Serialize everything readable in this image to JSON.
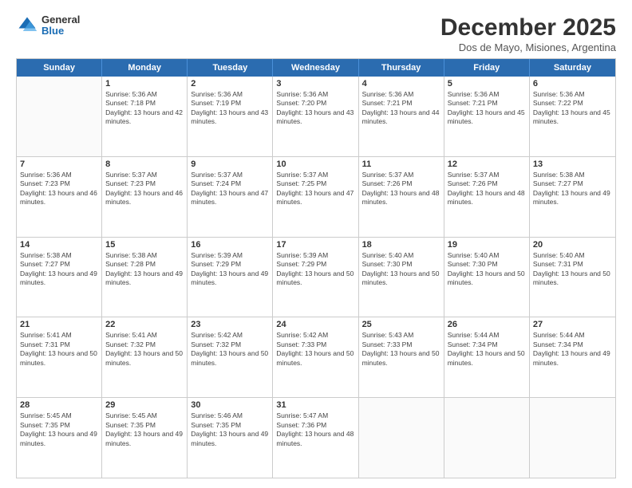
{
  "logo": {
    "general": "General",
    "blue": "Blue"
  },
  "title": "December 2025",
  "subtitle": "Dos de Mayo, Misiones, Argentina",
  "days": [
    "Sunday",
    "Monday",
    "Tuesday",
    "Wednesday",
    "Thursday",
    "Friday",
    "Saturday"
  ],
  "weeks": [
    [
      {
        "day": "",
        "empty": true
      },
      {
        "day": "1",
        "sunrise": "Sunrise: 5:36 AM",
        "sunset": "Sunset: 7:18 PM",
        "daylight": "Daylight: 13 hours and 42 minutes."
      },
      {
        "day": "2",
        "sunrise": "Sunrise: 5:36 AM",
        "sunset": "Sunset: 7:19 PM",
        "daylight": "Daylight: 13 hours and 43 minutes."
      },
      {
        "day": "3",
        "sunrise": "Sunrise: 5:36 AM",
        "sunset": "Sunset: 7:20 PM",
        "daylight": "Daylight: 13 hours and 43 minutes."
      },
      {
        "day": "4",
        "sunrise": "Sunrise: 5:36 AM",
        "sunset": "Sunset: 7:21 PM",
        "daylight": "Daylight: 13 hours and 44 minutes."
      },
      {
        "day": "5",
        "sunrise": "Sunrise: 5:36 AM",
        "sunset": "Sunset: 7:21 PM",
        "daylight": "Daylight: 13 hours and 45 minutes."
      },
      {
        "day": "6",
        "sunrise": "Sunrise: 5:36 AM",
        "sunset": "Sunset: 7:22 PM",
        "daylight": "Daylight: 13 hours and 45 minutes."
      }
    ],
    [
      {
        "day": "7",
        "sunrise": "Sunrise: 5:36 AM",
        "sunset": "Sunset: 7:23 PM",
        "daylight": "Daylight: 13 hours and 46 minutes."
      },
      {
        "day": "8",
        "sunrise": "Sunrise: 5:37 AM",
        "sunset": "Sunset: 7:23 PM",
        "daylight": "Daylight: 13 hours and 46 minutes."
      },
      {
        "day": "9",
        "sunrise": "Sunrise: 5:37 AM",
        "sunset": "Sunset: 7:24 PM",
        "daylight": "Daylight: 13 hours and 47 minutes."
      },
      {
        "day": "10",
        "sunrise": "Sunrise: 5:37 AM",
        "sunset": "Sunset: 7:25 PM",
        "daylight": "Daylight: 13 hours and 47 minutes."
      },
      {
        "day": "11",
        "sunrise": "Sunrise: 5:37 AM",
        "sunset": "Sunset: 7:26 PM",
        "daylight": "Daylight: 13 hours and 48 minutes."
      },
      {
        "day": "12",
        "sunrise": "Sunrise: 5:37 AM",
        "sunset": "Sunset: 7:26 PM",
        "daylight": "Daylight: 13 hours and 48 minutes."
      },
      {
        "day": "13",
        "sunrise": "Sunrise: 5:38 AM",
        "sunset": "Sunset: 7:27 PM",
        "daylight": "Daylight: 13 hours and 49 minutes."
      }
    ],
    [
      {
        "day": "14",
        "sunrise": "Sunrise: 5:38 AM",
        "sunset": "Sunset: 7:27 PM",
        "daylight": "Daylight: 13 hours and 49 minutes."
      },
      {
        "day": "15",
        "sunrise": "Sunrise: 5:38 AM",
        "sunset": "Sunset: 7:28 PM",
        "daylight": "Daylight: 13 hours and 49 minutes."
      },
      {
        "day": "16",
        "sunrise": "Sunrise: 5:39 AM",
        "sunset": "Sunset: 7:29 PM",
        "daylight": "Daylight: 13 hours and 49 minutes."
      },
      {
        "day": "17",
        "sunrise": "Sunrise: 5:39 AM",
        "sunset": "Sunset: 7:29 PM",
        "daylight": "Daylight: 13 hours and 50 minutes."
      },
      {
        "day": "18",
        "sunrise": "Sunrise: 5:40 AM",
        "sunset": "Sunset: 7:30 PM",
        "daylight": "Daylight: 13 hours and 50 minutes."
      },
      {
        "day": "19",
        "sunrise": "Sunrise: 5:40 AM",
        "sunset": "Sunset: 7:30 PM",
        "daylight": "Daylight: 13 hours and 50 minutes."
      },
      {
        "day": "20",
        "sunrise": "Sunrise: 5:40 AM",
        "sunset": "Sunset: 7:31 PM",
        "daylight": "Daylight: 13 hours and 50 minutes."
      }
    ],
    [
      {
        "day": "21",
        "sunrise": "Sunrise: 5:41 AM",
        "sunset": "Sunset: 7:31 PM",
        "daylight": "Daylight: 13 hours and 50 minutes."
      },
      {
        "day": "22",
        "sunrise": "Sunrise: 5:41 AM",
        "sunset": "Sunset: 7:32 PM",
        "daylight": "Daylight: 13 hours and 50 minutes."
      },
      {
        "day": "23",
        "sunrise": "Sunrise: 5:42 AM",
        "sunset": "Sunset: 7:32 PM",
        "daylight": "Daylight: 13 hours and 50 minutes."
      },
      {
        "day": "24",
        "sunrise": "Sunrise: 5:42 AM",
        "sunset": "Sunset: 7:33 PM",
        "daylight": "Daylight: 13 hours and 50 minutes."
      },
      {
        "day": "25",
        "sunrise": "Sunrise: 5:43 AM",
        "sunset": "Sunset: 7:33 PM",
        "daylight": "Daylight: 13 hours and 50 minutes."
      },
      {
        "day": "26",
        "sunrise": "Sunrise: 5:44 AM",
        "sunset": "Sunset: 7:34 PM",
        "daylight": "Daylight: 13 hours and 50 minutes."
      },
      {
        "day": "27",
        "sunrise": "Sunrise: 5:44 AM",
        "sunset": "Sunset: 7:34 PM",
        "daylight": "Daylight: 13 hours and 49 minutes."
      }
    ],
    [
      {
        "day": "28",
        "sunrise": "Sunrise: 5:45 AM",
        "sunset": "Sunset: 7:35 PM",
        "daylight": "Daylight: 13 hours and 49 minutes."
      },
      {
        "day": "29",
        "sunrise": "Sunrise: 5:45 AM",
        "sunset": "Sunset: 7:35 PM",
        "daylight": "Daylight: 13 hours and 49 minutes."
      },
      {
        "day": "30",
        "sunrise": "Sunrise: 5:46 AM",
        "sunset": "Sunset: 7:35 PM",
        "daylight": "Daylight: 13 hours and 49 minutes."
      },
      {
        "day": "31",
        "sunrise": "Sunrise: 5:47 AM",
        "sunset": "Sunset: 7:36 PM",
        "daylight": "Daylight: 13 hours and 48 minutes."
      },
      {
        "day": "",
        "empty": true
      },
      {
        "day": "",
        "empty": true
      },
      {
        "day": "",
        "empty": true
      }
    ]
  ]
}
